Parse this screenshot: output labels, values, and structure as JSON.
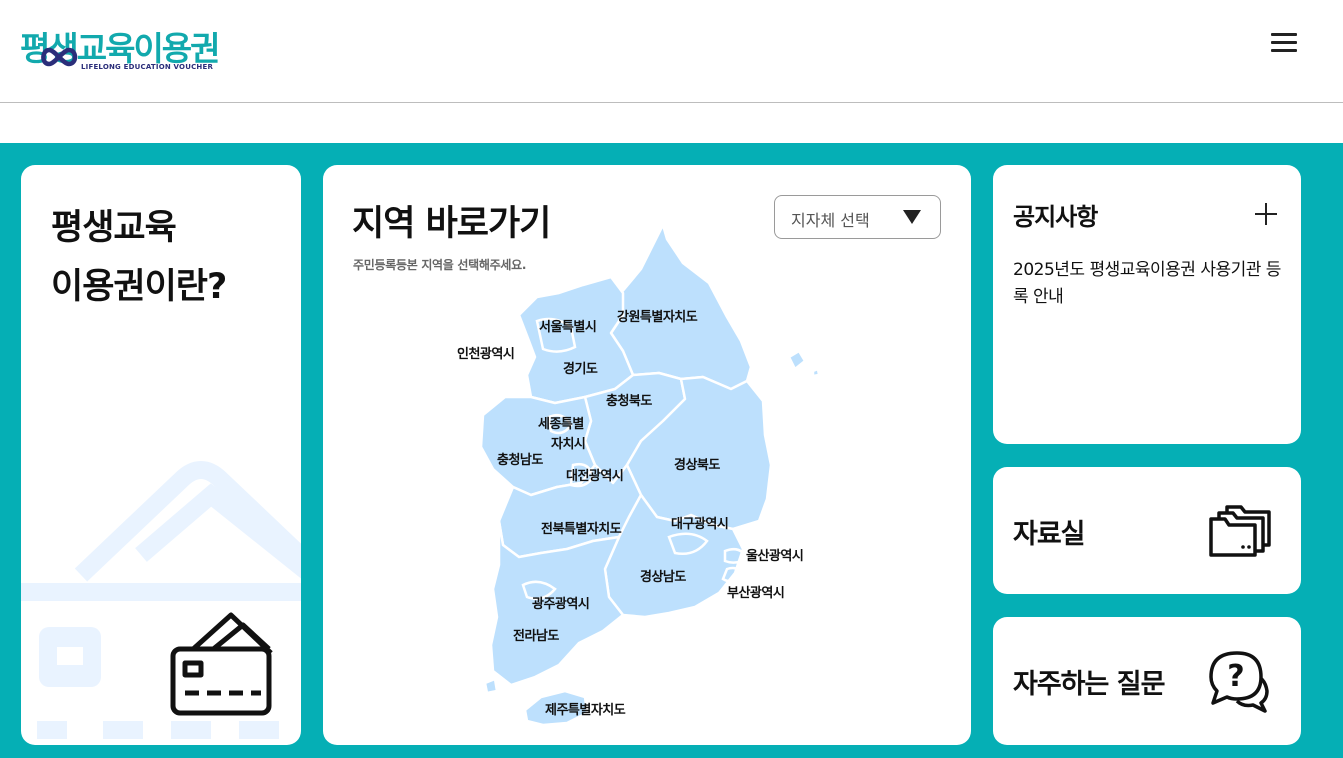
{
  "header": {
    "logo_text": "평생교육이용권",
    "logo_subtext": "LIFELONG EDUCATION VOUCHER",
    "brand_color": "#12a9ad",
    "menu_icon": "hamburger-menu-icon"
  },
  "intro": {
    "title_line1": "평생교육",
    "title_line2": "이용권이란?",
    "icon": "credit-card-icon"
  },
  "region": {
    "title": "지역 바로가기",
    "subtitle": "주민등록등본 지역을 선택해주세요.",
    "select_value": "지자체 선택",
    "regions": [
      "서울특별시",
      "강원특별자치도",
      "인천광역시",
      "경기도",
      "충청북도",
      "세종특별",
      "자치시",
      "충청남도",
      "대전광역시",
      "경상북도",
      "대구광역시",
      "전북특별자치도",
      "울산광역시",
      "경상남도",
      "부산광역시",
      "광주광역시",
      "전라남도",
      "제주특별자치도"
    ]
  },
  "notice": {
    "title": "공지사항",
    "more_icon": "plus-icon",
    "items": [
      "2025년도 평생교육이용권 사용기관 등록 안내"
    ]
  },
  "archive": {
    "title": "자료실",
    "icon": "folder-icon"
  },
  "faq": {
    "title": "자주하는 질문",
    "icon": "question-chat-icon"
  },
  "colors": {
    "background": "#05afb5",
    "map_fill": "#bfe0ff",
    "card": "#ffffff"
  }
}
